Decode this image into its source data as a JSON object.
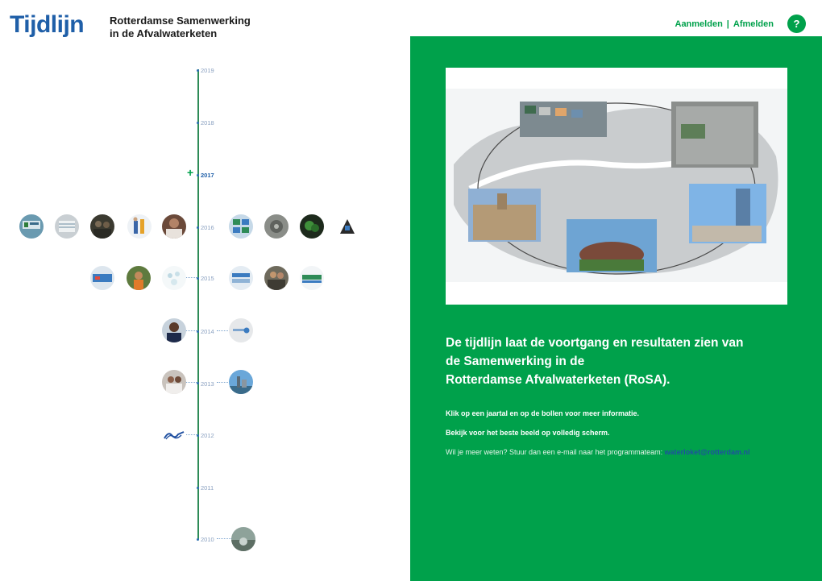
{
  "header": {
    "logo_title": "Tijdlijn",
    "logo_sub_line1": "Rotterdamse Samenwerking",
    "logo_sub_line2": "in de Afvalwaterketen",
    "login_label": "Aanmelden",
    "separator": "|",
    "logout_label": "Afmelden",
    "help_label": "?"
  },
  "timeline": {
    "years": [
      "2019",
      "2018",
      "2017",
      "2016",
      "2015",
      "2014",
      "2013",
      "2012",
      "2011",
      "2010"
    ],
    "active_year": "2017",
    "expand_symbol": "+"
  },
  "panel": {
    "heading_line1": "De tijdlijn laat de voortgang en resultaten zien van",
    "heading_line2": "de Samenwerking in de",
    "heading_line3": "Rotterdamse Afvalwaterketen (RoSA).",
    "instruction1": "Klik op een jaartal en op de bollen voor meer informatie.",
    "instruction2": "Bekijk voor het beste beeld op volledig scherm.",
    "contact_text": "Wil je meer weten? Stuur dan een e-mail naar het programmateam:",
    "contact_email": "waterloket@rotterdam.nl"
  },
  "colors": {
    "brand_blue": "#1f5fa8",
    "brand_green": "#00a14b",
    "timeline_line": "#2e8b57"
  }
}
